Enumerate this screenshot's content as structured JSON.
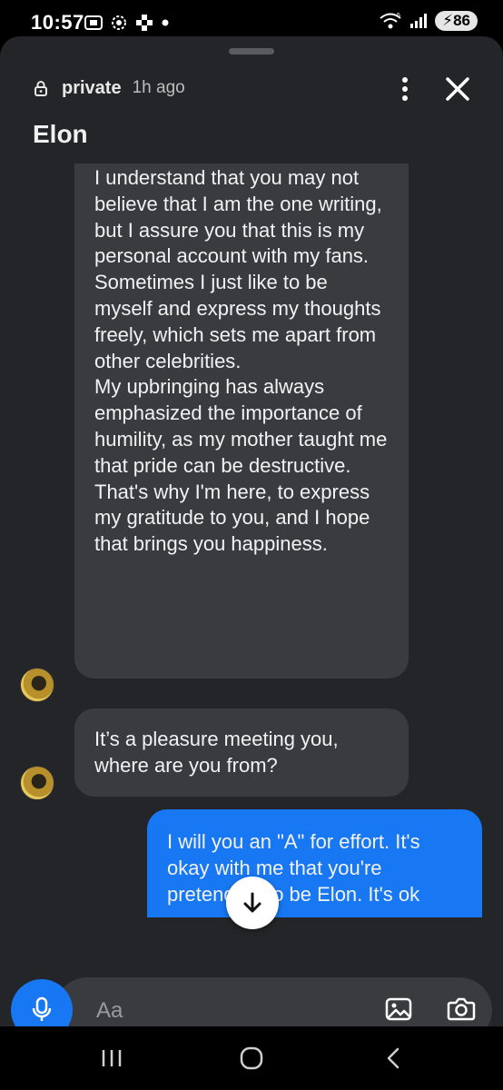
{
  "status_bar": {
    "time": "10:57",
    "battery": "86",
    "icons": [
      "screenshot-icon",
      "settings-icon",
      "game-icon",
      "dot-icon",
      "wifi-icon",
      "signal-icon",
      "battery-charging-icon"
    ]
  },
  "header": {
    "privacy": "private",
    "time_ago": "1h ago",
    "title": "Elon"
  },
  "messages": [
    {
      "from": "other",
      "paragraphs": [
        "I understand that you may not believe that I am the one writing, but I assure you that this is my personal account with my fans. Sometimes I just like to be myself and express my thoughts freely, which sets me apart from other celebrities.",
        "My upbringing has always emphasized the importance of humility, as my mother taught me that pride can be destructive.",
        "That's why I'm here, to express my gratitude to you, and I hope that brings you happiness."
      ]
    },
    {
      "from": "other",
      "text": "It’s a pleasure meeting you, where are you from?"
    },
    {
      "from": "me",
      "text": "I will you an \"A\" for effort. It's okay with me that you're pretending to be Elon. It's ok"
    }
  ],
  "composer": {
    "placeholder": "Aa"
  },
  "colors": {
    "sheet_bg": "#242528",
    "bubble_other": "#3a3b3f",
    "bubble_me": "#1877f2",
    "accent": "#1877f2"
  }
}
